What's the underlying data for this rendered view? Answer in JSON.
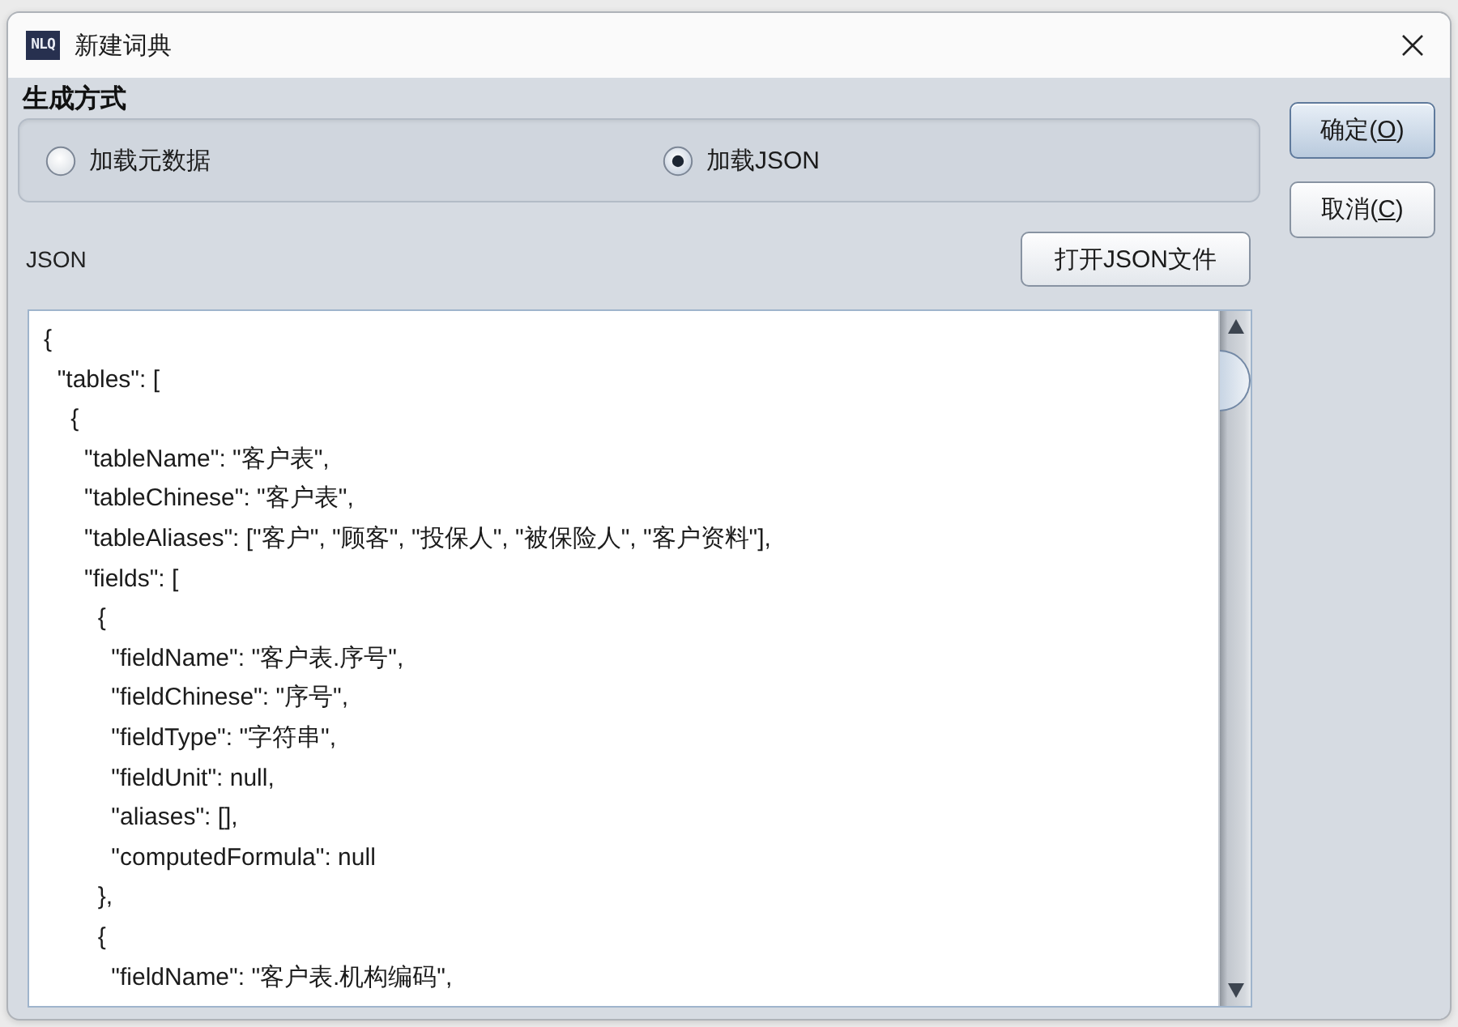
{
  "window": {
    "icon_text": "NLQ",
    "title": "新建词典"
  },
  "generation_mode": {
    "title": "生成方式",
    "options": [
      {
        "label": "加载元数据",
        "selected": false
      },
      {
        "label": "加载JSON",
        "selected": true
      }
    ]
  },
  "json_section": {
    "label": "JSON",
    "open_button": "打开JSON文件",
    "editor": {
      "value": "{\n  \"tables\": [\n    {\n      \"tableName\": \"客户表\",\n      \"tableChinese\": \"客户表\",\n      \"tableAliases\": [\"客户\", \"顾客\", \"投保人\", \"被保险人\", \"客户资料\"],\n      \"fields\": [\n        {\n          \"fieldName\": \"客户表.序号\",\n          \"fieldChinese\": \"序号\",\n          \"fieldType\": \"字符串\",\n          \"fieldUnit\": null,\n          \"aliases\": [],\n          \"computedFormula\": null\n        },\n        {\n          \"fieldName\": \"客户表.机构编码\","
    }
  },
  "dialog_buttons": [
    {
      "text_before": "确定(",
      "mnemonic": "O",
      "text_after": ")",
      "default": true
    },
    {
      "text_before": "取消(",
      "mnemonic": "C",
      "text_after": ")",
      "default": false
    }
  ]
}
